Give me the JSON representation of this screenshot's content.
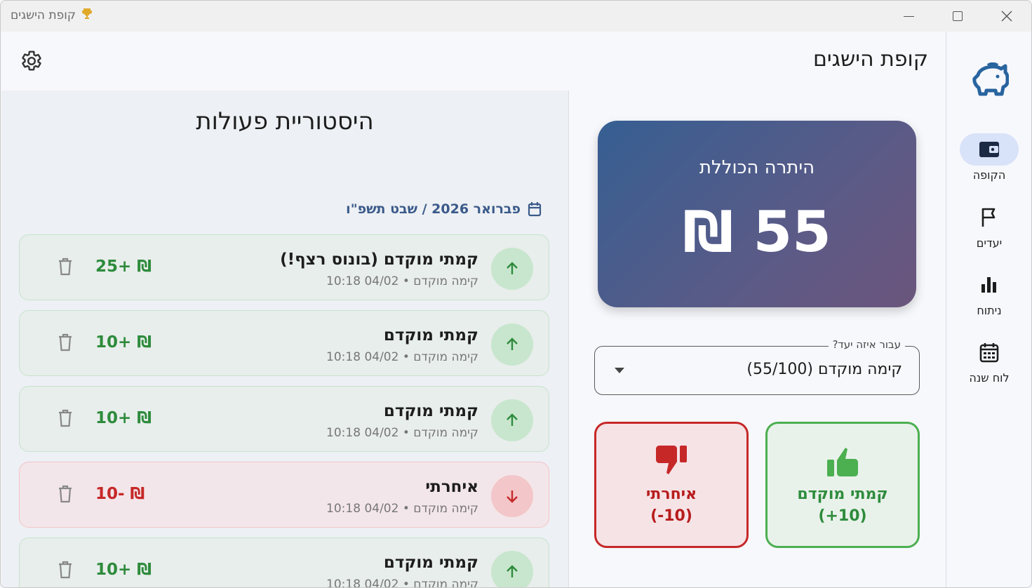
{
  "window": {
    "title": "קופת הישגים"
  },
  "header": {
    "title": "קופת הישגים"
  },
  "nav": {
    "items": [
      {
        "label": "הקופה",
        "icon": "wallet-icon",
        "active": true
      },
      {
        "label": "יעדים",
        "icon": "flag-icon",
        "active": false
      },
      {
        "label": "ניתוח",
        "icon": "bar-chart-icon",
        "active": false
      },
      {
        "label": "לוח שנה",
        "icon": "calendar-icon",
        "active": false
      }
    ]
  },
  "history": {
    "title": "היסטוריית פעולות",
    "month": "פברואר 2026 / שבט תשפ\"ו",
    "transactions": [
      {
        "name": "קמתי מוקדם (בונוס רצף!)",
        "sub": "קימה מוקדם • 04/02 10:18",
        "amount": "25+ ₪",
        "type": "positive"
      },
      {
        "name": "קמתי מוקדם",
        "sub": "קימה מוקדם • 04/02 10:18",
        "amount": "10+ ₪",
        "type": "positive"
      },
      {
        "name": "קמתי מוקדם",
        "sub": "קימה מוקדם • 04/02 10:18",
        "amount": "10+ ₪",
        "type": "positive"
      },
      {
        "name": "איחרתי",
        "sub": "קימה מוקדם • 04/02 10:18",
        "amount": "10- ₪",
        "type": "negative"
      },
      {
        "name": "קמתי מוקדם",
        "sub": "קימה מוקדם • 04/02 10:18",
        "amount": "10+ ₪",
        "type": "positive"
      }
    ]
  },
  "balance": {
    "label": "היתרה הכוללת",
    "amount": "55 ₪"
  },
  "goal_select": {
    "legend": "עבור איזה יעד?",
    "value": "קימה מוקדם (55/100)"
  },
  "actions": {
    "fail": {
      "label": "איחרתי",
      "amount": "(-10)"
    },
    "success": {
      "label": "קמתי מוקדם",
      "amount": "(+10)"
    }
  },
  "colors": {
    "accent": "#3a5a8a",
    "positive": "#2e8b3c",
    "negative": "#c62828"
  }
}
